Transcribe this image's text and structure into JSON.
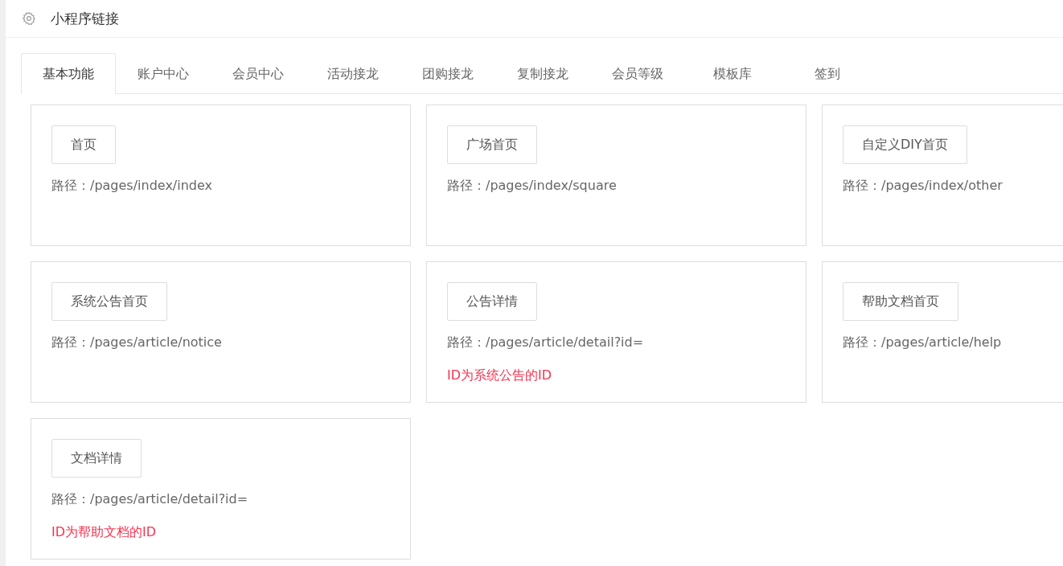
{
  "header": {
    "title": "小程序链接"
  },
  "tabs": [
    {
      "label": "基本功能",
      "selected": true
    },
    {
      "label": "账户中心",
      "selected": false
    },
    {
      "label": "会员中心",
      "selected": false
    },
    {
      "label": "活动接龙",
      "selected": false
    },
    {
      "label": "团购接龙",
      "selected": false
    },
    {
      "label": "复制接龙",
      "selected": false
    },
    {
      "label": "会员等级",
      "selected": false
    },
    {
      "label": "模板库",
      "selected": false
    },
    {
      "label": "签到",
      "selected": false
    }
  ],
  "cards": [
    {
      "button": "首页",
      "path": "路径：/pages/index/index"
    },
    {
      "button": "广场首页",
      "path": "路径：/pages/index/square"
    },
    {
      "button": "自定义DIY首页",
      "path": "路径：/pages/index/other"
    },
    {
      "button": "系统公告首页",
      "path": "路径：/pages/article/notice"
    },
    {
      "button": "公告详情",
      "path": "路径：/pages/article/detail?id=",
      "note": "ID为系统公告的ID"
    },
    {
      "button": "帮助文档首页",
      "path": "路径：/pages/article/help"
    },
    {
      "button": "文档详情",
      "path": "路径：/pages/article/detail?id=",
      "note": "ID为帮助文档的ID"
    }
  ]
}
